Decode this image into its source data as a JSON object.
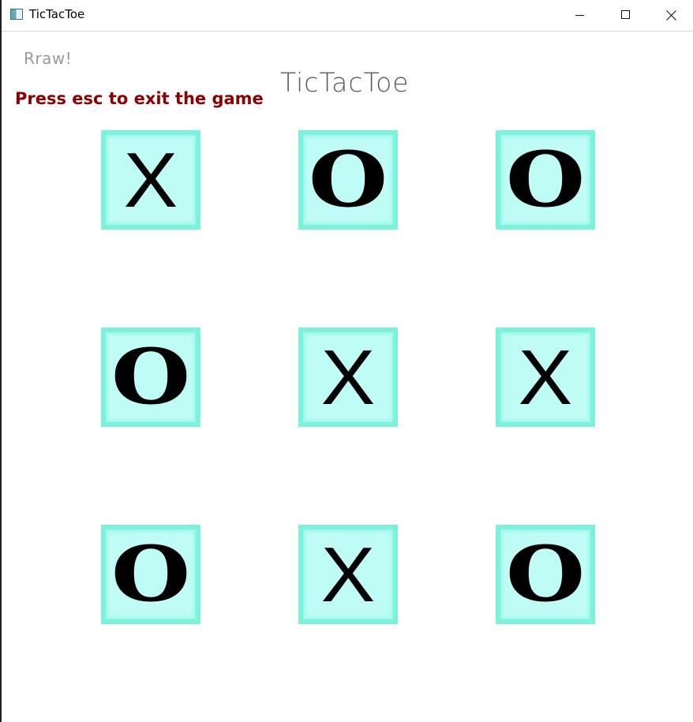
{
  "window": {
    "title": "TicTacToe",
    "icon": "app-window-icon",
    "controls": {
      "minimize_icon": "minimize-icon",
      "maximize_icon": "maximize-icon",
      "close_icon": "close-icon"
    }
  },
  "game": {
    "status": "Rraw!",
    "title": "TicTacToe",
    "hint": "Press esc to exit the game",
    "board": [
      "X",
      "O",
      "O",
      "O",
      "X",
      "X",
      "O",
      "X",
      "O"
    ]
  },
  "colors": {
    "cell_fill": "#c0fcf6",
    "cell_border": "#7cf2dd",
    "hint_text": "#8b0000",
    "status_text": "#9a9a9a",
    "title_text": "#5a5a5a",
    "mark": "#000000"
  }
}
